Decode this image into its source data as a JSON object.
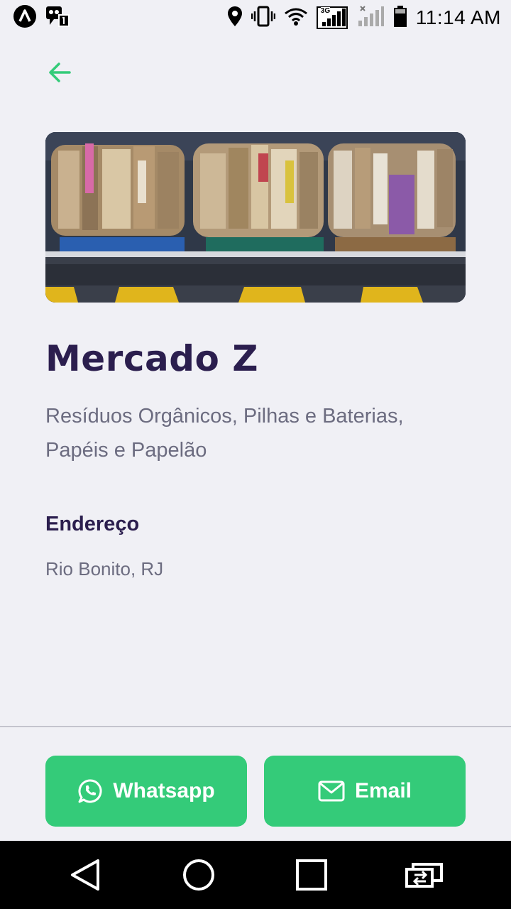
{
  "status_bar": {
    "time": "11:14 AM",
    "network_label": "3G",
    "icons": [
      "app-a-icon",
      "notification-icon",
      "location-icon",
      "vibrate-icon",
      "wifi-icon",
      "signal-3g-icon",
      "signal-no-sim-icon",
      "battery-icon"
    ]
  },
  "header": {
    "back_icon": "arrow-left-icon"
  },
  "hero": {
    "image": "recycling-cardboard-bales"
  },
  "point": {
    "name": "Mercado Z",
    "items": "Resíduos Orgânicos, Pilhas e Baterias, Papéis e Papelão",
    "address_label": "Endereço",
    "address": "Rio Bonito, RJ"
  },
  "footer": {
    "whatsapp_label": "Whatsapp",
    "email_label": "Email",
    "whatsapp_icon": "whatsapp-icon",
    "email_icon": "mail-icon"
  },
  "navigation": {
    "buttons": [
      "back-triangle-icon",
      "home-circle-icon",
      "recents-square-icon",
      "switch-app-icon"
    ]
  },
  "colors": {
    "accent": "#34cb79",
    "title": "#2b1e4e",
    "text": "#6c6c80",
    "background": "#f0f0f5"
  }
}
